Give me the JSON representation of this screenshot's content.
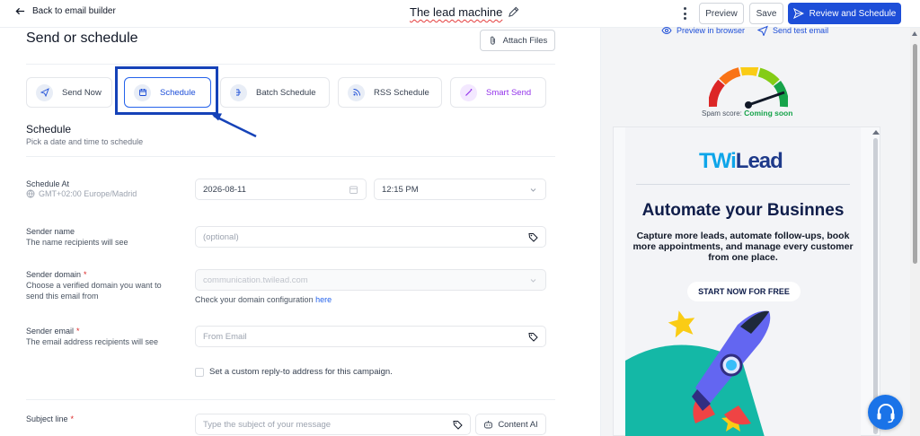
{
  "topbar": {
    "back_label": "Back to email builder",
    "doc_title": "The lead machine",
    "preview_label": "Preview",
    "save_label": "Save",
    "review_label": "Review and Schedule"
  },
  "page": {
    "title": "Send or schedule",
    "attach_label": "Attach Files"
  },
  "send_options": [
    {
      "label": "Send Now",
      "icon": "send-icon"
    },
    {
      "label": "Schedule",
      "icon": "calendar-icon",
      "selected": true
    },
    {
      "label": "Batch Schedule",
      "icon": "batch-icon"
    },
    {
      "label": "RSS Schedule",
      "icon": "rss-icon"
    },
    {
      "label": "Smart Send",
      "icon": "magic-wand-icon"
    }
  ],
  "schedule": {
    "title": "Schedule",
    "subtitle": "Pick a date and time to schedule",
    "at_label": "Schedule At",
    "timezone": "GMT+02:00 Europe/Madrid",
    "date_value": "2026-08-11",
    "time_value": "12:15 PM"
  },
  "sender_name": {
    "label": "Sender name",
    "help": "The name recipients will see",
    "placeholder": "(optional)"
  },
  "sender_domain": {
    "label": "Sender domain",
    "help": "Choose a verified domain you want to send this email from",
    "value": "communication.twilead.com",
    "check_text": "Check your domain configuration",
    "check_link": "here"
  },
  "sender_email": {
    "label": "Sender email",
    "help": "The email address recipients will see",
    "placeholder": "From Email"
  },
  "reply_to": {
    "label": "Set a custom reply-to address for this campaign.",
    "checked": false
  },
  "subject": {
    "label": "Subject line",
    "placeholder": "Type the subject of your message",
    "ai_label": "Content AI"
  },
  "preview": {
    "browser_label": "Preview in browser",
    "test_label": "Send test email",
    "spam_prefix": "Spam score:",
    "spam_value": "Coming soon"
  },
  "email": {
    "logo_tw": "TWi",
    "logo_rest": "Lead",
    "headline": "Automate your Businnes",
    "body": "Capture more leads, automate follow-ups, book more appointments, and manage every customer from one place.",
    "cta": "START NOW FOR FREE"
  },
  "colors": {
    "primary": "#1d4ed8",
    "highlight": "#1542b8",
    "smart": "#9333ea",
    "required": "#dc2626",
    "spam_ok": "#16a34a"
  }
}
